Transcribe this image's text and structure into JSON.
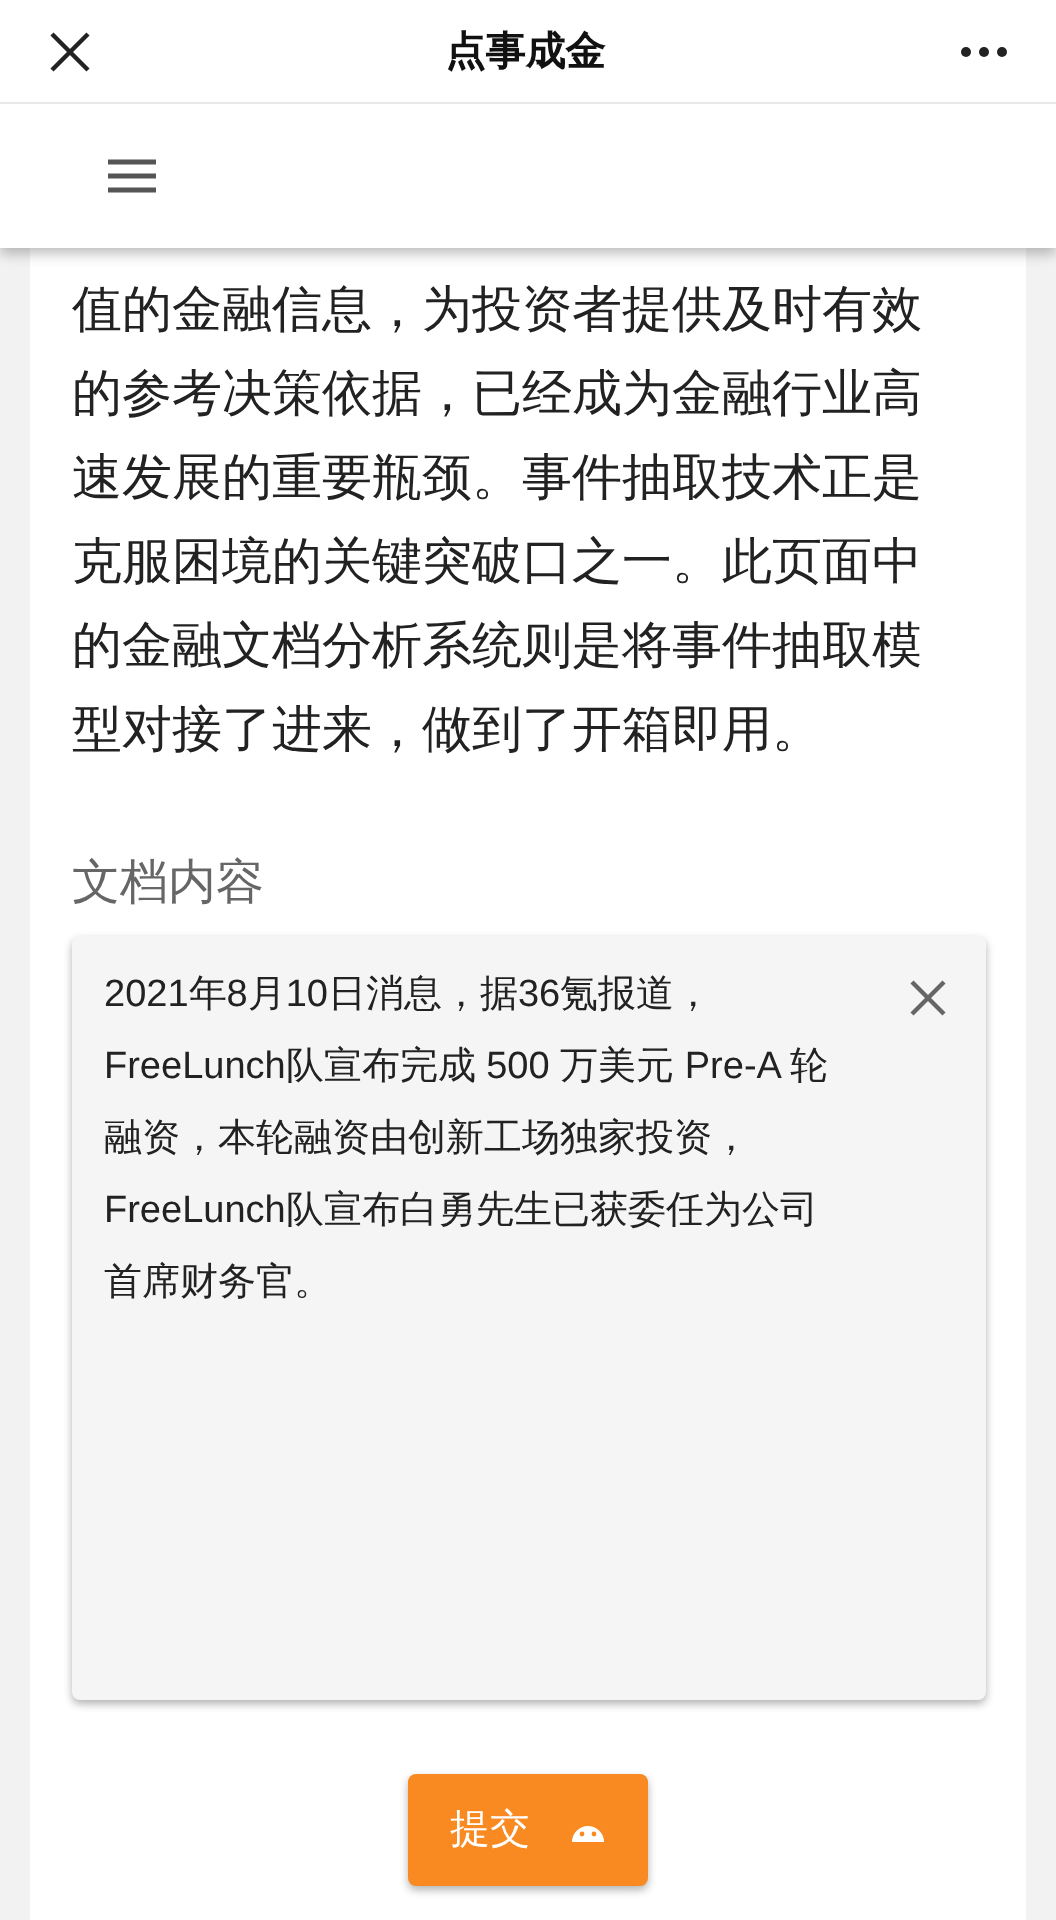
{
  "window": {
    "title": "点事成金"
  },
  "intro": "值的金融信息，为投资者提供及时有效的参考决策依据，已经成为金融行业高速发展的重要瓶颈。事件抽取技术正是克服困境的关键突破口之一。此页面中的金融文档分析系统则是将事件抽取模型对接了进来，做到了开箱即用。",
  "document": {
    "label": "文档内容",
    "value": "2021年8月10日消息，据36氪报道，FreeLunch队宣布完成 500 万美元 Pre-A 轮融资，本轮融资由创新工场独家投资，FreeLunch队宣布白勇先生已获委任为公司首席财务官。"
  },
  "submit": {
    "label": "提交"
  }
}
